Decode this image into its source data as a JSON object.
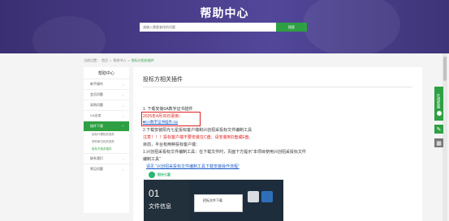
{
  "header": {
    "title": "帮助中心",
    "search_placeholder": "请输入需要查找的问题",
    "search_button": "搜索"
  },
  "breadcrumb": {
    "items": [
      "当前位置：",
      "首页",
      ">",
      "帮助中心",
      ">"
    ],
    "current": "投标方相关插件"
  },
  "sidebar": {
    "heading": "帮助中心",
    "items": [
      {
        "label": "新手操作",
        "active": false
      },
      {
        "label": "会员问题",
        "active": false
      },
      {
        "label": "采购问题",
        "active": false
      },
      {
        "label": "CA业务",
        "active": false
      },
      {
        "label": "插件下载",
        "active": true
      }
    ],
    "subitems": [
      {
        "label": "招标代理相关插件",
        "active": false
      },
      {
        "label": "采购单位相关插件",
        "active": false
      },
      {
        "label": "投标方相关插件",
        "active": true
      }
    ],
    "items_after": [
      {
        "label": "联系我们",
        "active": false
      },
      {
        "label": "常见问题",
        "active": false
      }
    ]
  },
  "main": {
    "title": "投标方相关插件",
    "step1": "1. 下载安装0A数字证书插件",
    "update_date": "2025年4月30日更新：",
    "download_link": "■CA数字证书插件.zip",
    "step2": "2.下载安装阳光七星投标客户端和兴创招采投标文件编制工具",
    "warning": "注意！！！投标客户端不要安装在C盘，请安装到D盘或E盘。",
    "platform_note": "目前，平台有两种投标客户端：",
    "tool_note": "1.兴创招采投标文件编制工具：在下载文件时，页面下方提示“本项目使用兴创招采投标文件",
    "tool_note2": "编制工具”",
    "tool_link": "请见 “兴创招采投标文件编制工具下载安装操作流程”",
    "shot": {
      "brand": "阳光七星",
      "number": "01",
      "label": "文件信息",
      "dialog_text": "招标文件下载"
    }
  },
  "floating": {
    "service_label": "在线客服",
    "edit_icon": "edit-icon",
    "qr_icon": "qrcode-icon"
  },
  "colors": {
    "brand_green": "#2ea043",
    "hero_purple": "#4a3d8a",
    "warning_red": "#e02020",
    "link_blue": "#1a5cc8"
  }
}
